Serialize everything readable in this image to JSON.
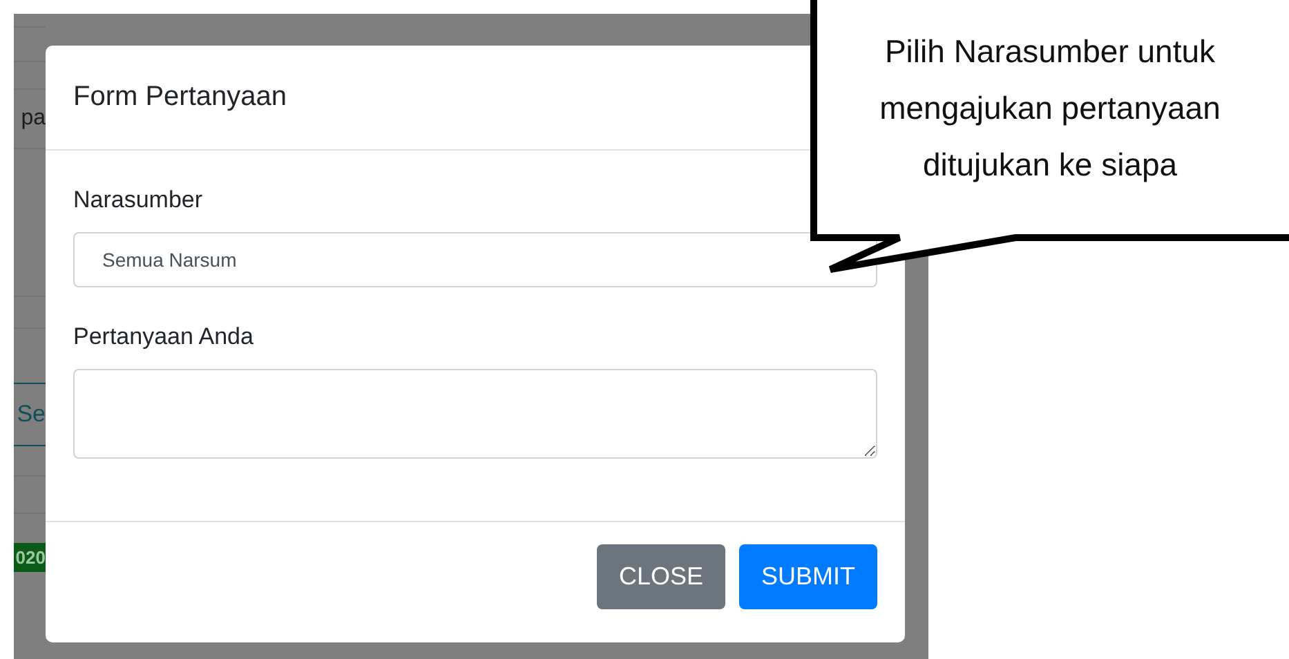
{
  "background_page": {
    "row_text": "pa",
    "button": "Se",
    "badge": "020"
  },
  "modal": {
    "title": "Form Pertanyaan",
    "fields": [
      {
        "kind": "select",
        "label": "Narasumber",
        "value": "Semua Narsum"
      },
      {
        "kind": "textarea",
        "label": "Pertanyaan Anda"
      }
    ],
    "buttons": [
      {
        "label": "CLOSE",
        "kind": "secondary"
      },
      {
        "label": "SUBMIT",
        "kind": "primary"
      }
    ]
  },
  "callout": {
    "text": "Pilih Narasumber untuk mengajukan pertanyaan ditujukan ke siapa"
  }
}
